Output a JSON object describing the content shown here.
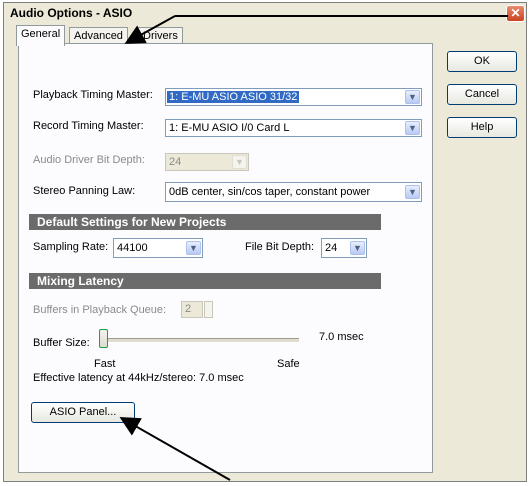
{
  "window": {
    "title": "Audio Options - ASIO",
    "close_label": "✕"
  },
  "tabs": [
    {
      "label": "General"
    },
    {
      "label": "Advanced"
    },
    {
      "label": "Drivers"
    }
  ],
  "buttons": {
    "ok": "OK",
    "cancel": "Cancel",
    "help": "Help",
    "asio_panel": "ASIO Panel..."
  },
  "general": {
    "playback_timing": {
      "label": "Playback Timing Master:",
      "value": "1: E-MU ASIO ASIO 31/32"
    },
    "record_timing": {
      "label": "Record Timing Master:",
      "value": "1: E-MU ASIO I/0 Card L"
    },
    "bit_depth": {
      "label": "Audio Driver Bit Depth:",
      "value": "24"
    },
    "panning": {
      "label": "Stereo Panning Law:",
      "value": "0dB center, sin/cos taper, constant power"
    }
  },
  "defaults_group": {
    "header": "Default Settings for New Projects",
    "sampling_rate": {
      "label": "Sampling Rate:",
      "value": "44100"
    },
    "file_bit_depth": {
      "label": "File Bit Depth:",
      "value": "24"
    }
  },
  "latency_group": {
    "header": "Mixing Latency",
    "buffers": {
      "label": "Buffers in Playback Queue:",
      "value": "2"
    },
    "buffer_size": {
      "label": "Buffer Size:",
      "readout": "7.0 msec",
      "position_fraction": 0.0
    },
    "fast_label": "Fast",
    "safe_label": "Safe",
    "effective": "Effective latency at 44kHz/stereo: 7.0 msec"
  },
  "icons": {
    "dropdown": "chevron-down-icon",
    "close": "close-icon"
  },
  "colors": {
    "selection": "#316ac5",
    "group_header": "#6b6b6b",
    "close": "#c9451f"
  }
}
